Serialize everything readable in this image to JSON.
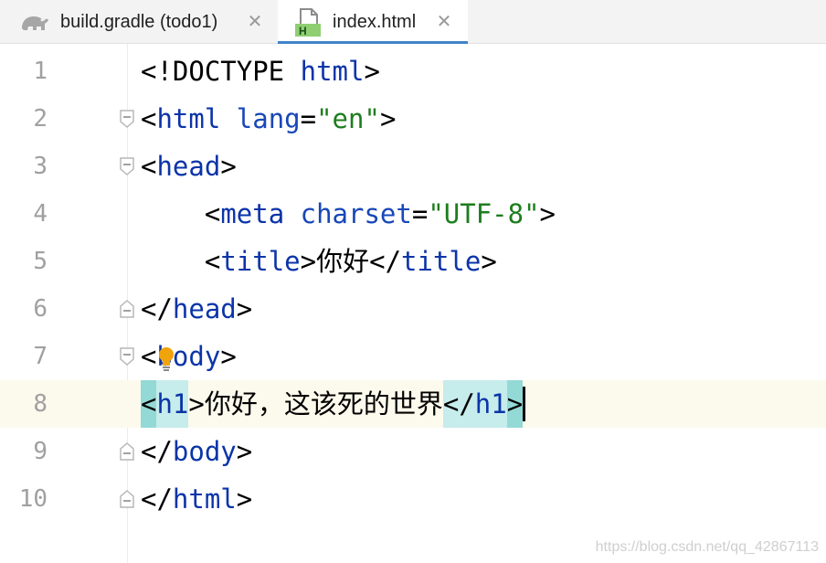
{
  "tabs": [
    {
      "label": "build.gradle (todo1)",
      "icon": "gradle-elephant-icon",
      "active": false
    },
    {
      "label": "index.html",
      "icon": "html-file-icon",
      "icon_letter": "H",
      "active": true
    }
  ],
  "colors": {
    "active_tab_underline": "#4083c9",
    "tag": "#0b34a8",
    "attribute": "#1747b8",
    "string": "#1e7d1e",
    "current_line": "#fcfaed",
    "bracket_match": "#93d9d6",
    "tag_match": "#c6ecec",
    "bulb": "#f0a30a"
  },
  "editor": {
    "lines": [
      {
        "number": "1",
        "lt": "<",
        "doctype": "!DOCTYPE",
        "name": "html",
        "gt": ">"
      },
      {
        "number": "2",
        "lt": "<",
        "tag": "html",
        "attr": "lang",
        "eq": "=",
        "value": "\"en\"",
        "gt": ">"
      },
      {
        "number": "3",
        "lt": "<",
        "tag": "head",
        "gt": ">"
      },
      {
        "number": "4",
        "indent": "    ",
        "lt": "<",
        "tag": "meta",
        "attr": "charset",
        "eq": "=",
        "value": "\"UTF-8\"",
        "gt": ">"
      },
      {
        "number": "5",
        "indent": "    ",
        "lt": "<",
        "tag": "title",
        "gt": ">",
        "text": "你好",
        "close_lt": "</",
        "close_tag": "title",
        "close_gt": ">"
      },
      {
        "number": "6",
        "lt": "</",
        "tag": "head",
        "gt": ">"
      },
      {
        "number": "7",
        "lt": "<",
        "tag": "body",
        "gt": ">"
      },
      {
        "number": "8",
        "lt": "<",
        "tag": "h1",
        "gt": ">",
        "text": "你好，这该死的世界",
        "close_lt": "</",
        "close_tag": "h1",
        "close_gt": ">"
      },
      {
        "number": "9",
        "lt": "</",
        "tag": "body",
        "gt": ">"
      },
      {
        "number": "10",
        "lt": "</",
        "tag": "html",
        "gt": ">"
      }
    ],
    "current_line": "8"
  },
  "watermark": "https://blog.csdn.net/qq_42867113"
}
